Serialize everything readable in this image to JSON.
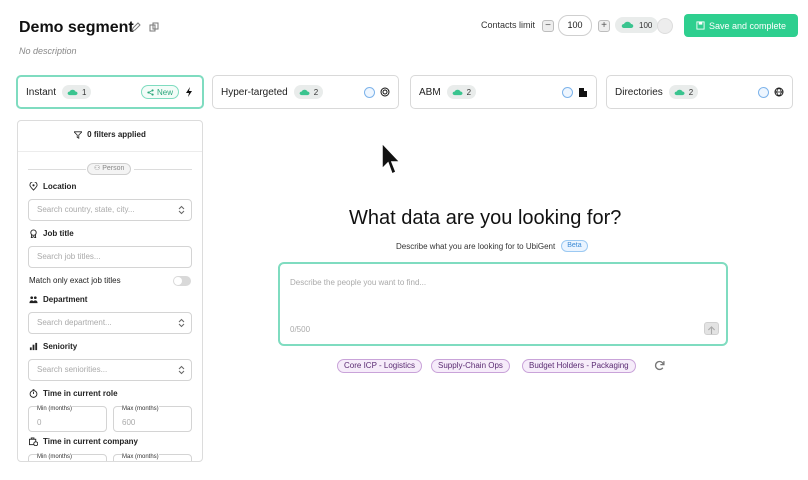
{
  "header": {
    "title": "Demo segment",
    "description": "No description",
    "contacts_limit_label": "Contacts limit",
    "limit_value": "100",
    "minus_label": "−",
    "plus_label": "+",
    "credits": "100",
    "save_label": "Save and complete"
  },
  "tabs": [
    {
      "label": "Instant",
      "count": "1",
      "badge": "New",
      "active": true
    },
    {
      "label": "Hyper-targeted",
      "count": "2"
    },
    {
      "label": "ABM",
      "count": "2"
    },
    {
      "label": "Directories",
      "count": "2"
    }
  ],
  "filters": {
    "applied_label": "0 filters applied",
    "section_label": "Person",
    "location": {
      "label": "Location",
      "placeholder": "Search country, state, city..."
    },
    "job_title": {
      "label": "Job title",
      "placeholder": "Search job titles..."
    },
    "exact_match_label": "Match only exact job titles",
    "department": {
      "label": "Department",
      "placeholder": "Search department..."
    },
    "seniority": {
      "label": "Seniority",
      "placeholder": "Search seniorities..."
    },
    "time_in_role": {
      "label": "Time in current role",
      "min_caption": "Min (months)",
      "min_value": "0",
      "max_caption": "Max (months)",
      "max_value": "600"
    },
    "time_in_company": {
      "label": "Time in current company",
      "min_caption": "Min (months)",
      "max_caption": "Max (months)"
    }
  },
  "main": {
    "heading": "What data are you looking for?",
    "subheading": "Describe what you are looking for to UbiGent",
    "beta_label": "Beta",
    "textarea_placeholder": "Describe the people you want to find...",
    "char_count": "0/500",
    "suggestions": [
      "Core ICP - Logistics",
      "Supply-Chain Ops",
      "Budget Holders - Packaging"
    ]
  },
  "colors": {
    "accent": "#2ecf8f",
    "accent_border": "#7fdcc0",
    "chip_bg": "#f6ecfa",
    "chip_border": "#c9a3d9"
  }
}
